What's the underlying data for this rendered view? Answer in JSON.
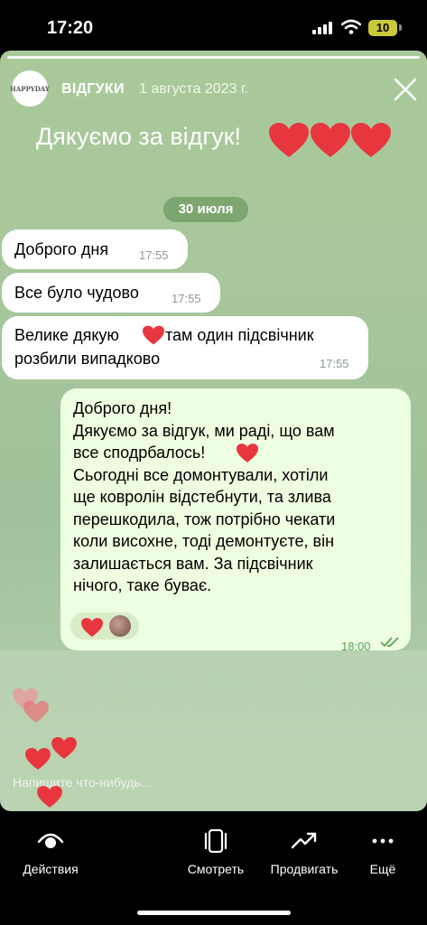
{
  "status_bar": {
    "time": "17:20",
    "battery": "10"
  },
  "story": {
    "channel": "ВІДГУКИ",
    "date": "1 августа 2023 г.",
    "avatar_text": "HAPPYDAY",
    "caption": "Дякуємо за відгук!",
    "input_placeholder": "Напишите что-нибудь..."
  },
  "chat": {
    "day_label": "30 июля",
    "incoming": [
      {
        "text": "Доброго дня",
        "time": "17:55"
      },
      {
        "text": "Все було чудово",
        "time": "17:55"
      },
      {
        "text_part1": "Велике дякую",
        "text_part2": "там один підсвічник",
        "text_line2": "розбили випадково",
        "time": "17:55"
      }
    ],
    "outgoing": {
      "lines": [
        "Доброго дня!",
        "Дякуємо за відгук, ми раді, що вам",
        "все сподрбалось!",
        "Сьогодні все домонтували, хотіли",
        "ще ковролін відстебнути, та злива",
        "перешкодила, тож потрібно чекати",
        "коли висохне, тоді демонтуєте, він",
        "залишається вам. За підсвічник",
        "нічого, таке буває."
      ],
      "time": "18:00"
    }
  },
  "bottom_bar": {
    "actions": "Действия",
    "view": "Смотреть",
    "promote": "Продвигать",
    "more": "Ещё"
  },
  "colors": {
    "heart": "#e8363e",
    "outgoing_bubble": "#eefee0",
    "story_bg": "#a8c79c"
  }
}
